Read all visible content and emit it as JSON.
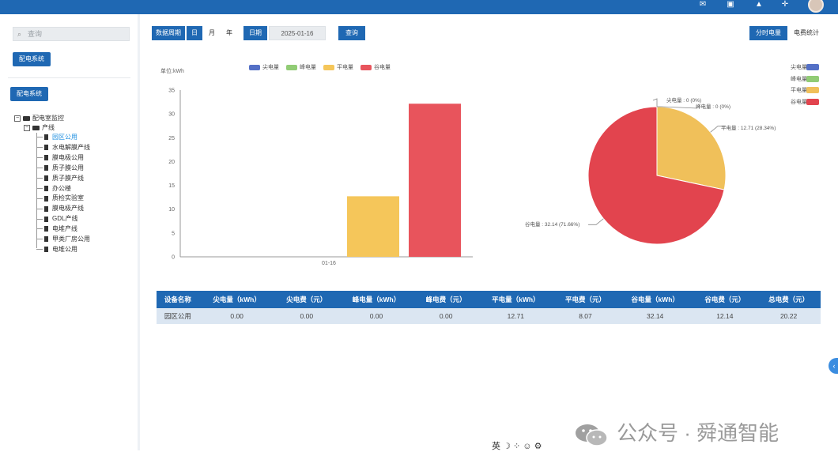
{
  "topbar": {
    "icons": [
      "mail-icon",
      "screen-icon",
      "bell-icon",
      "fullscreen-icon"
    ]
  },
  "sidebar": {
    "search_placeholder": "查询",
    "system_button": "配电系统",
    "system_button_2": "配电系统",
    "tree": {
      "root": "配电室监控",
      "child": "产线",
      "leaves": [
        "园区公用",
        "水电解膜产线",
        "膜电极公用",
        "质子膜公用",
        "质子膜产线",
        "办公楼",
        "质检实验室",
        "膜电极产线",
        "GDL产线",
        "电堆产线",
        "甲类厂房公用",
        "电堆公用"
      ],
      "selected_index": 0
    }
  },
  "filters": {
    "period_label": "数据周期",
    "period_options": [
      "日",
      "月",
      "年"
    ],
    "date_label": "日期",
    "date_value": "2025-01-16",
    "query_button": "查询",
    "tab_active": "分时电量",
    "tab_other": "电费统计"
  },
  "chart_data": [
    {
      "type": "bar",
      "ylabel": "单位:kWh",
      "categories": [
        "01-16"
      ],
      "ylim": [
        0,
        35
      ],
      "yticks": [
        0,
        5,
        10,
        15,
        20,
        25,
        30,
        35
      ],
      "series": [
        {
          "name": "尖电量",
          "color": "#5470c6",
          "values": [
            0
          ]
        },
        {
          "name": "峰电量",
          "color": "#91cc75",
          "values": [
            0
          ]
        },
        {
          "name": "平电量",
          "color": "#f5c65a",
          "values": [
            12.71
          ]
        },
        {
          "name": "谷电量",
          "color": "#e8545c",
          "values": [
            32.14
          ]
        }
      ],
      "legend_position": "top"
    },
    {
      "type": "pie",
      "slices": [
        {
          "name": "尖电量",
          "value": 0,
          "percent": "0%",
          "color": "#5470c6",
          "label": "尖电量 : 0 (0%)"
        },
        {
          "name": "峰电量",
          "value": 0,
          "percent": "0%",
          "color": "#91cc75",
          "label": "峰电量 : 0 (0%)"
        },
        {
          "name": "平电量",
          "value": 12.71,
          "percent": "28.34%",
          "color": "#f0c05a",
          "label": "平电量 : 12.71 (28.34%)"
        },
        {
          "name": "谷电量",
          "value": 32.14,
          "percent": "71.66%",
          "color": "#e2444e",
          "label": "谷电量 : 32.14 (71.66%)"
        }
      ],
      "legend_position": "right"
    }
  ],
  "table": {
    "headers": [
      "设备名称",
      "尖电量（kWh）",
      "尖电费（元）",
      "峰电量（kWh）",
      "峰电费（元）",
      "平电量（kWh）",
      "平电费（元）",
      "谷电量（kWh）",
      "谷电费（元）",
      "总电费（元）"
    ],
    "rows": [
      [
        "园区公用",
        "0.00",
        "0.00",
        "0.00",
        "0.00",
        "12.71",
        "8.07",
        "32.14",
        "12.14",
        "20.22"
      ]
    ]
  },
  "ime_bar": "英",
  "watermark": "公众号 · 舜通智能"
}
